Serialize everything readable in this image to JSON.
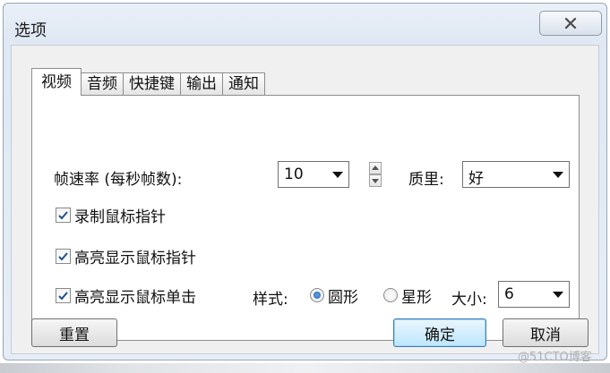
{
  "window": {
    "title": "选项"
  },
  "tabs": [
    {
      "label": "视频",
      "active": true
    },
    {
      "label": "音频",
      "active": false
    },
    {
      "label": "快捷键",
      "active": false
    },
    {
      "label": "输出",
      "active": false
    },
    {
      "label": "通知",
      "active": false
    }
  ],
  "video": {
    "frame_rate_label": "帧速率 (每秒帧数):",
    "frame_rate_value": "10",
    "quality_label": "质里:",
    "quality_value": "好",
    "record_pointer": {
      "label": "录制鼠标指针",
      "checked": true
    },
    "highlight_pointer": {
      "label": "高亮显示鼠标指针",
      "checked": true
    },
    "highlight_click": {
      "label": "高亮显示鼠标单击",
      "checked": true
    },
    "style_label": "样式:",
    "style_options": [
      {
        "label": "圆形",
        "selected": true
      },
      {
        "label": "星形",
        "selected": false
      }
    ],
    "size_label": "大小:",
    "size_value": "6"
  },
  "buttons": {
    "reset": "重置",
    "ok": "确定",
    "cancel": "取消"
  },
  "watermark": "@51CTO博客",
  "colors": {
    "check_mark": "#1e4f8f",
    "default_button_border": "#3c7fb1"
  }
}
